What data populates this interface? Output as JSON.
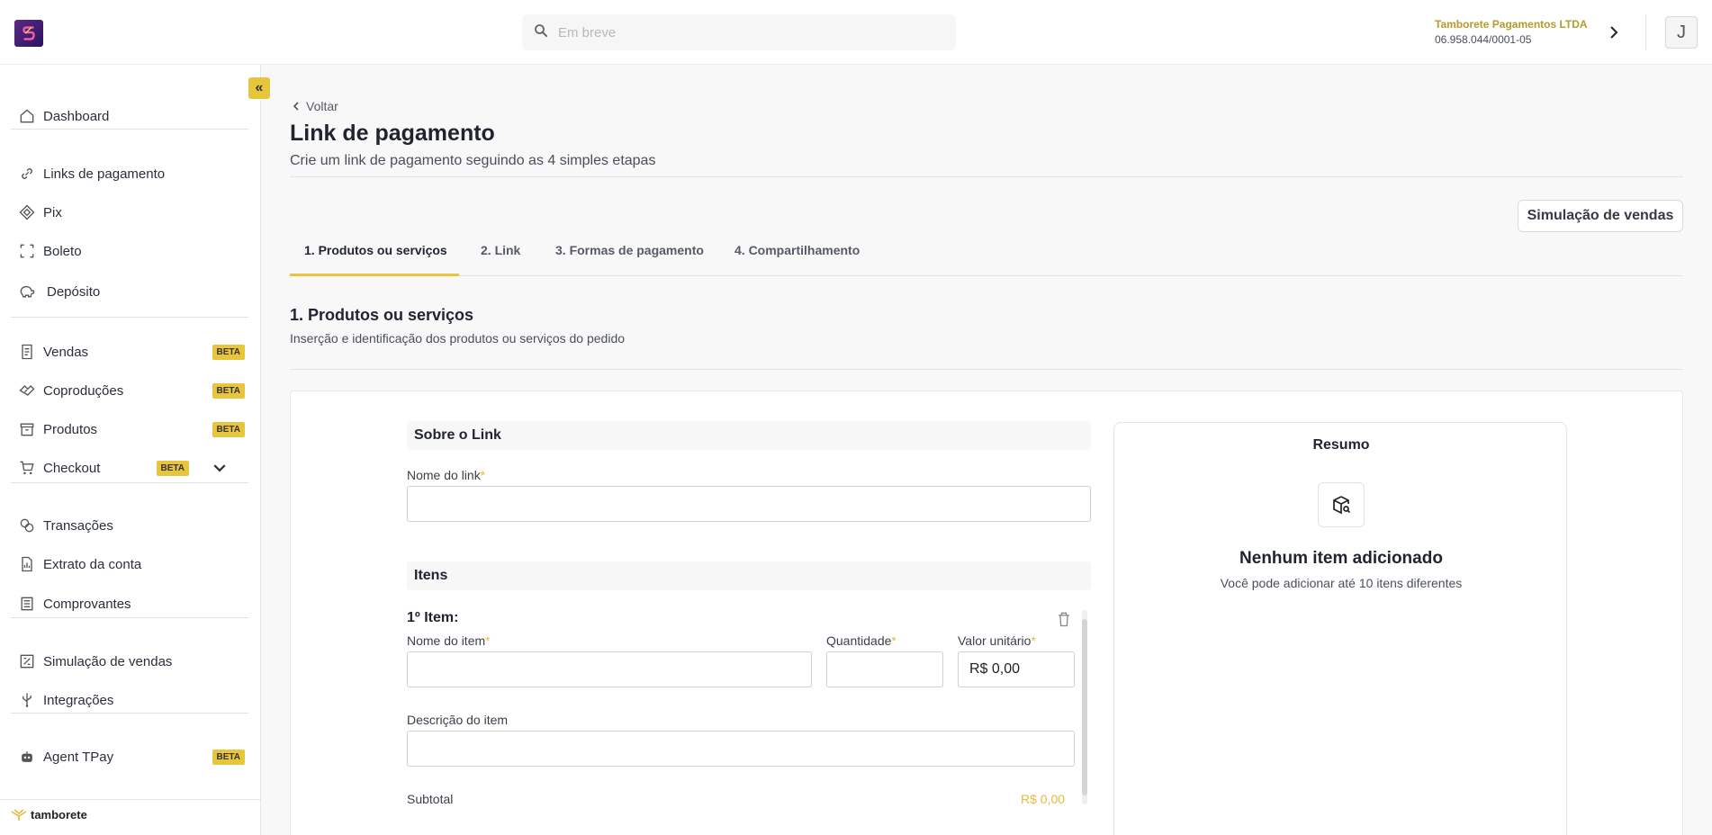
{
  "topbar": {
    "search_placeholder": "Em breve",
    "company_name": "Tamborete Pagamentos LTDA",
    "company_id": "06.958.044/0001-05",
    "avatar_initial": "J"
  },
  "sidebar": {
    "collapse_label": "«",
    "items": [
      {
        "label": "Dashboard"
      },
      {
        "label": "Links de pagamento"
      },
      {
        "label": "Pix"
      },
      {
        "label": "Boleto"
      },
      {
        "label": "Depósito"
      },
      {
        "label": "Vendas",
        "badge": "BETA"
      },
      {
        "label": "Coproduções",
        "badge": "BETA"
      },
      {
        "label": "Produtos",
        "badge": "BETA"
      },
      {
        "label": "Checkout",
        "badge": "BETA"
      },
      {
        "label": "Transações"
      },
      {
        "label": "Extrato da conta"
      },
      {
        "label": "Comprovantes"
      },
      {
        "label": "Simulação de vendas"
      },
      {
        "label": "Integrações"
      },
      {
        "label": "Agent TPay",
        "badge": "BETA"
      }
    ],
    "brand": "tamborete"
  },
  "main": {
    "back_label": "Voltar",
    "title": "Link de pagamento",
    "subtitle": "Crie um link de pagamento seguindo as 4 simples etapas",
    "simulation_button": "Simulação de vendas",
    "tabs": [
      {
        "label": "1. Produtos ou serviços",
        "active": true
      },
      {
        "label": "2. Link"
      },
      {
        "label": "3. Formas de pagamento"
      },
      {
        "label": "4. Compartilhamento"
      }
    ],
    "section_title": "1. Produtos ou serviços",
    "section_subtitle": "Inserção e identificação dos produtos ou serviços do pedido"
  },
  "form": {
    "about_heading": "Sobre o Link",
    "link_name_label": "Nome do link",
    "link_name_value": "",
    "items_heading": "Itens",
    "item_title": "1º Item:",
    "item_name_label": "Nome do item",
    "item_name_value": "",
    "quantity_label": "Quantidade",
    "quantity_value": "",
    "unit_price_label": "Valor unitário",
    "unit_price_value": "R$ 0,00",
    "description_label": "Descrição do item",
    "description_value": "",
    "subtotal_label": "Subtotal",
    "subtotal_value": "R$ 0,00",
    "required_mark": "*"
  },
  "summary": {
    "title": "Resumo",
    "empty_title": "Nenhum item adicionado",
    "empty_subtitle": "Você pode adicionar até 10 itens diferentes"
  },
  "colors": {
    "accent": "#e7c53c",
    "accent_text": "#b69a2c",
    "logo": "#5b2a86"
  },
  "icons": [
    "logo-icon",
    "search-icon",
    "chevron-right-icon",
    "home-icon",
    "link-icon",
    "pix-icon",
    "boleto-icon",
    "piggy-bank-icon",
    "receipt-icon",
    "handshake-icon",
    "box-icon",
    "cart-icon",
    "chevron-down-icon",
    "transactions-icon",
    "statement-icon",
    "document-list-icon",
    "calculator-icon",
    "usb-icon",
    "robot-icon",
    "tamborete-logo-icon",
    "chevron-left-icon",
    "trash-icon",
    "package-search-icon"
  ]
}
